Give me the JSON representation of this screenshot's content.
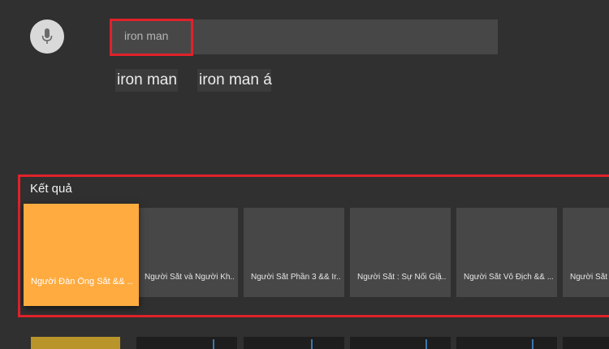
{
  "search": {
    "query": "iron man",
    "mic_icon": "mic-icon"
  },
  "suggestions": [
    "iron man",
    "iron man á"
  ],
  "results": {
    "heading": "Kết quả",
    "cards": [
      {
        "title": "Người Đàn Ông Sắt && ..."
      },
      {
        "title": "Người Sắt và Người Kh..."
      },
      {
        "title": "Người Sắt Phần 3 && Ir..."
      },
      {
        "title": "Người Sắt : Sự Nổi Giậ..."
      },
      {
        "title": "Người Sắt Vô Địch && ..."
      },
      {
        "title": "Người Sắt && ..."
      }
    ]
  },
  "colors": {
    "background": "#303030",
    "focus_card": "#ffab40",
    "annotation": "#e0222a"
  }
}
